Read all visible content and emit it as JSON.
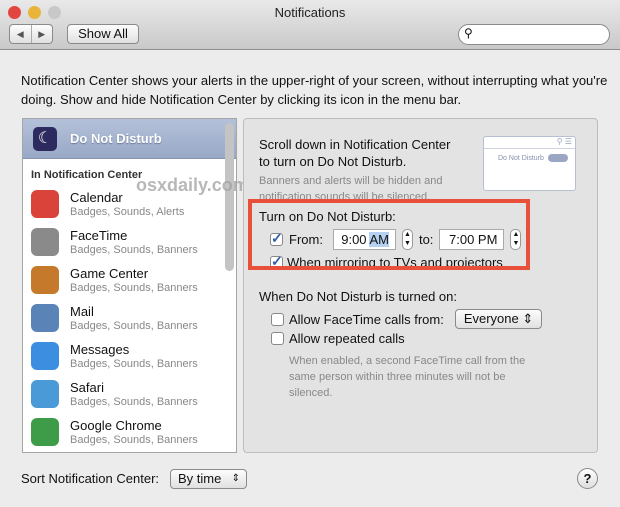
{
  "window": {
    "title": "Notifications",
    "back": "◀",
    "forward": "▶",
    "show_all": "Show All",
    "search_placeholder": ""
  },
  "description": "Notification Center shows your alerts in the upper-right of your screen, without interrupting what you're doing. Show and hide Notification Center by clicking its icon in the menu bar.",
  "watermark": "osxdaily.com",
  "sidebar": {
    "selected": "Do Not Disturb",
    "section": "In Notification Center",
    "items": [
      {
        "name": "Calendar",
        "sub": "Badges, Sounds, Alerts",
        "color": "#d9433a"
      },
      {
        "name": "FaceTime",
        "sub": "Badges, Sounds, Banners",
        "color": "#8a8a8a"
      },
      {
        "name": "Game Center",
        "sub": "Badges, Sounds, Banners",
        "color": "#c47a2a"
      },
      {
        "name": "Mail",
        "sub": "Badges, Sounds, Banners",
        "color": "#5a84b8"
      },
      {
        "name": "Messages",
        "sub": "Badges, Sounds, Banners",
        "color": "#3c8ee0"
      },
      {
        "name": "Safari",
        "sub": "Badges, Sounds, Banners",
        "color": "#4a9ad8"
      },
      {
        "name": "Google Chrome",
        "sub": "Badges, Sounds, Banners",
        "color": "#3e9b48"
      }
    ]
  },
  "panel": {
    "intro": "Scroll down in Notification Center to turn on Do Not Disturb.",
    "intro_sub": "Banners and alerts will be hidden and notification sounds will be silenced.",
    "preview_label": "Do Not Disturb",
    "schedule_title": "Turn on Do Not Disturb:",
    "from_label": "From:",
    "from_time": "9:00",
    "from_ampm": "AM",
    "to_label": "to:",
    "to_time": "7:00 PM",
    "from_checked": true,
    "mirroring_label": "When mirroring to TVs and projectors",
    "mirroring_checked": true,
    "when_title": "When Do Not Disturb is turned on:",
    "facetime_label": "Allow FaceTime calls from:",
    "facetime_value": "Everyone",
    "facetime_checked": false,
    "repeated_label": "Allow repeated calls",
    "repeated_checked": false,
    "repeated_sub": "When enabled, a second FaceTime call from the same person within three minutes will not be silenced.",
    "highlight_color": "#e8503a"
  },
  "footer": {
    "sort_label": "Sort Notification Center:",
    "sort_value": "By time",
    "help": "?"
  }
}
